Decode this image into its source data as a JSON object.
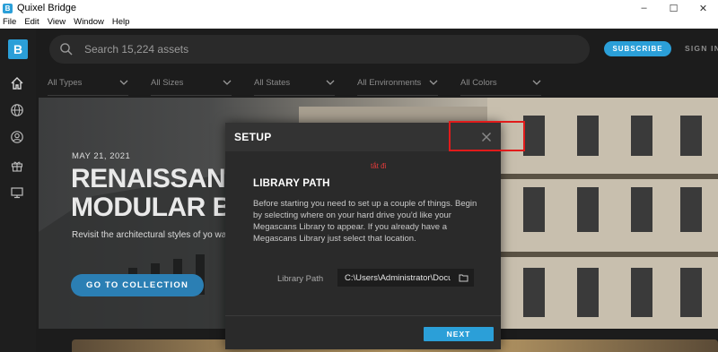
{
  "window": {
    "title": "Quixel Bridge",
    "app_icon_letter": "B",
    "minimize": "–",
    "maximize": "☐",
    "close": "✕"
  },
  "menu": [
    "File",
    "Edit",
    "View",
    "Window",
    "Help"
  ],
  "rail": {
    "logo_letter": "B",
    "icons": [
      "home-icon",
      "globe-icon",
      "user-icon",
      "gift-icon",
      "monitor-icon"
    ]
  },
  "header": {
    "search_placeholder": "Search 15,224 assets",
    "subscribe_label": "SUBSCRIBE",
    "signin_label": "SIGN IN"
  },
  "filters": [
    "All Types",
    "All Sizes",
    "All States",
    "All Environments",
    "All Colors"
  ],
  "hero": {
    "date": "MAY 21, 2021",
    "title": "RENAISSANCE R\nMODULAR BUI",
    "subtitle": "Revisit the architectural styles of yo\nway.",
    "cta_label": "GO TO COLLECTION"
  },
  "modal": {
    "title": "SETUP",
    "annotation": "tắt đi",
    "section_title": "LIBRARY PATH",
    "description": "Before starting you need to set up a couple of things. Begin by selecting where on your hard drive you'd like your Megascans Library to appear. If you already have a Megascans Library just select that location.",
    "field_label": "Library Path",
    "path_value": "C:\\Users\\Administrator\\Docu",
    "next_label": "NEXT"
  },
  "colors": {
    "accent": "#2b9fd8",
    "annotation_red": "#e11b1b"
  }
}
